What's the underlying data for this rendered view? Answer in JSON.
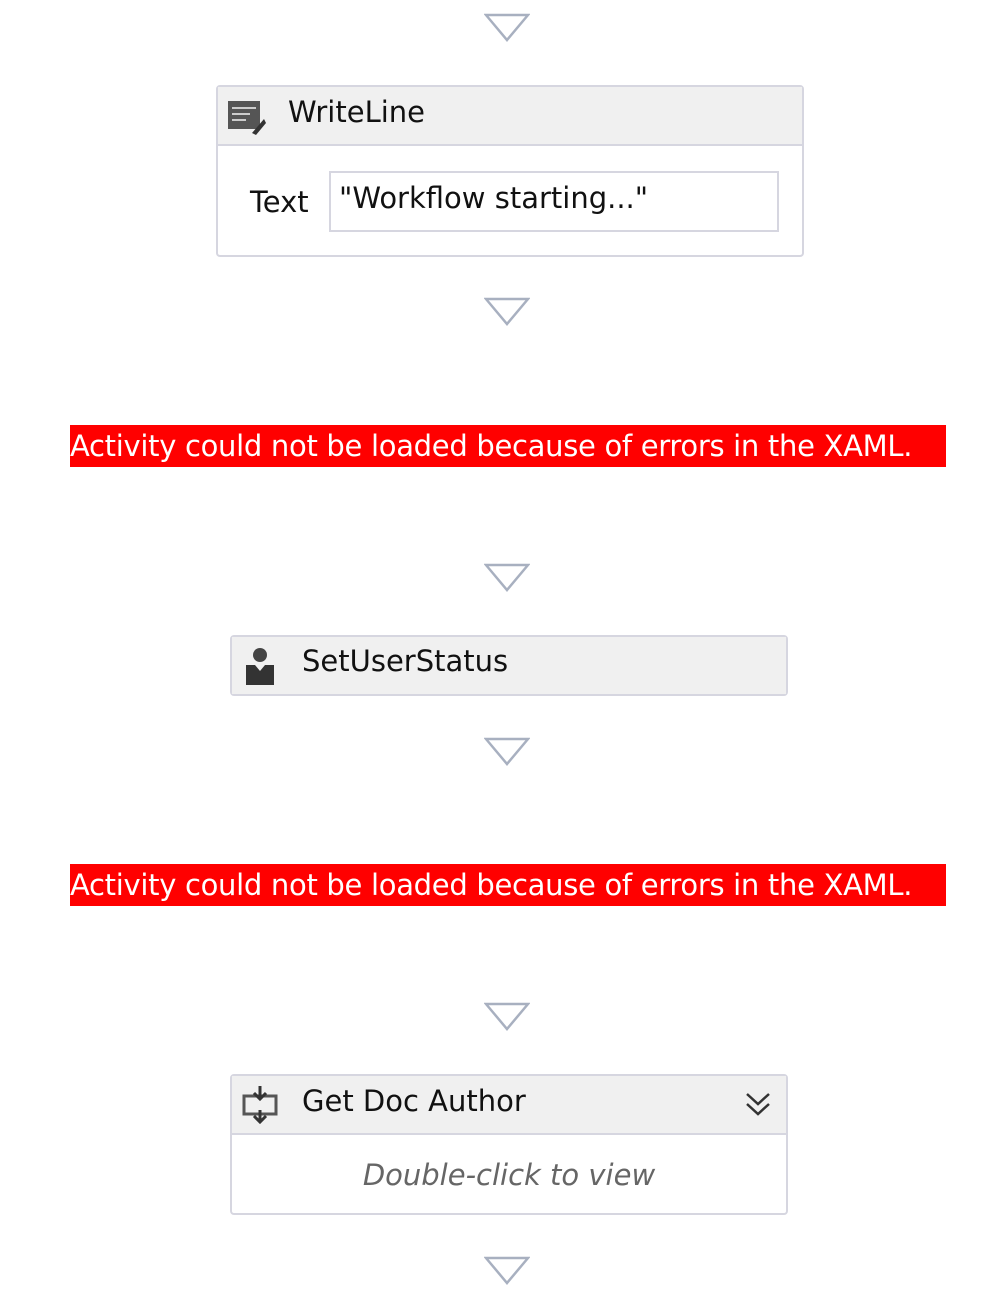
{
  "activities": [
    {
      "title": "WriteLine",
      "icon": "writeline-icon",
      "field_label": "Text",
      "field_value": "\"Workflow starting...\""
    },
    {
      "error": "Activity could not be loaded because of errors in the XAML."
    },
    {
      "title": "SetUserStatus",
      "icon": "user-icon"
    },
    {
      "error": "Activity could not be loaded because of errors in the XAML."
    },
    {
      "title": "Get Doc Author",
      "icon": "sequence-icon",
      "body": "Double-click to view",
      "expand_icon": "double-chevron-down-icon"
    }
  ],
  "colors": {
    "error_bg": "#ff0000",
    "header_bg": "#f0f0f0",
    "border": "#d6d6e0",
    "arrow": "#a8b0c0"
  }
}
